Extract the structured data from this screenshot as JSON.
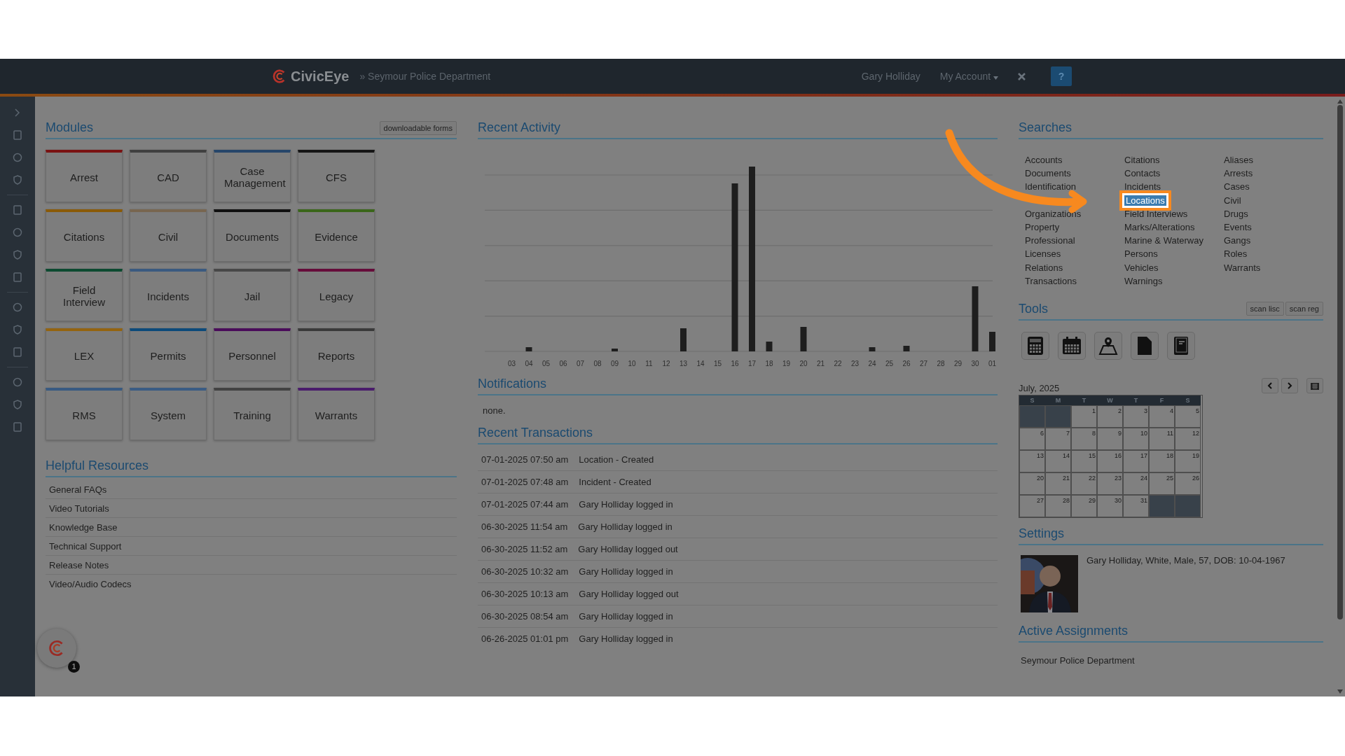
{
  "header": {
    "logo": "CivicEye",
    "breadcrumb": "» Seymour Police Department",
    "user": "Gary Holliday",
    "account_menu": "My Account",
    "help": "?"
  },
  "modules": {
    "title": "Modules",
    "forms_button": "downloadable forms",
    "items": [
      {
        "label": "Arrest",
        "color": "#7a1212"
      },
      {
        "label": "CAD",
        "color": "#404040"
      },
      {
        "label": "Case Management",
        "color": "#26466a"
      },
      {
        "label": "CFS",
        "color": "#151515"
      },
      {
        "label": "Citations",
        "color": "#8a5a08"
      },
      {
        "label": "Civil",
        "color": "#786650"
      },
      {
        "label": "Documents",
        "color": "#101010"
      },
      {
        "label": "Evidence",
        "color": "#3a661a"
      },
      {
        "label": "Field Interview",
        "color": "#0c4a30"
      },
      {
        "label": "Incidents",
        "color": "#3a5a80"
      },
      {
        "label": "Jail",
        "color": "#484848"
      },
      {
        "label": "Legacy",
        "color": "#660c3a"
      },
      {
        "label": "LEX",
        "color": "#946410"
      },
      {
        "label": "Permits",
        "color": "#0c4a7a"
      },
      {
        "label": "Personnel",
        "color": "#4a0c5a"
      },
      {
        "label": "Reports",
        "color": "#3a3a3a"
      },
      {
        "label": "RMS",
        "color": "#385a82"
      },
      {
        "label": "System",
        "color": "#3a5c84"
      },
      {
        "label": "Training",
        "color": "#424242"
      },
      {
        "label": "Warrants",
        "color": "#4a1c6c"
      }
    ]
  },
  "helpful_resources": {
    "title": "Helpful Resources",
    "links": [
      "General FAQs",
      "Video Tutorials",
      "Knowledge Base",
      "Technical Support",
      "Release Notes",
      "Video/Audio Codecs"
    ]
  },
  "recent_activity": {
    "title": "Recent Activity",
    "days": [
      "03",
      "04",
      "05",
      "06",
      "07",
      "08",
      "09",
      "10",
      "11",
      "12",
      "13",
      "14",
      "15",
      "16",
      "17",
      "18",
      "19",
      "20",
      "21",
      "22",
      "23",
      "24",
      "25",
      "26",
      "27",
      "28",
      "29",
      "30",
      "01"
    ]
  },
  "notifications": {
    "title": "Notifications",
    "text": "none."
  },
  "recent_transactions": {
    "title": "Recent Transactions",
    "rows": [
      {
        "time": "07-01-2025 07:50 am",
        "event": "Location - Created"
      },
      {
        "time": "07-01-2025 07:48 am",
        "event": "Incident - Created"
      },
      {
        "time": "07-01-2025 07:44 am",
        "event": "Gary Holliday logged in"
      },
      {
        "time": "06-30-2025 11:54 am",
        "event": "Gary Holliday logged in"
      },
      {
        "time": "06-30-2025 11:52 am",
        "event": "Gary Holliday logged out"
      },
      {
        "time": "06-30-2025 10:32 am",
        "event": "Gary Holliday logged in"
      },
      {
        "time": "06-30-2025 10:13 am",
        "event": "Gary Holliday logged out"
      },
      {
        "time": "06-30-2025 08:54 am",
        "event": "Gary Holliday logged in"
      },
      {
        "time": "06-26-2025 01:01 pm",
        "event": "Gary Holliday logged in"
      }
    ]
  },
  "searches": {
    "title": "Searches",
    "columns": [
      [
        {
          "label": "Accounts",
          "selected": false
        },
        {
          "label": "Documents",
          "selected": false
        },
        {
          "label": "Identification",
          "selected": false
        },
        {
          "label": "Organizations",
          "selected": false,
          "gap_before": true
        },
        {
          "label": "Property",
          "selected": false
        },
        {
          "label": "Professional",
          "selected": false
        },
        {
          "label": "Licenses",
          "selected": false
        },
        {
          "label": "Relations",
          "selected": false
        },
        {
          "label": "Transactions",
          "selected": false
        }
      ],
      [
        {
          "label": "Citations",
          "selected": false
        },
        {
          "label": "Contacts",
          "selected": false
        },
        {
          "label": "Incidents",
          "selected": false
        },
        {
          "label": "Locations",
          "selected": true
        },
        {
          "label": "Field Interviews",
          "selected": false
        },
        {
          "label": "Marks/Alterations",
          "selected": false
        },
        {
          "label": "Marine & Waterway",
          "selected": false
        },
        {
          "label": "Persons",
          "selected": false
        },
        {
          "label": "Vehicles",
          "selected": false
        },
        {
          "label": "Warnings",
          "selected": false
        }
      ],
      [
        {
          "label": "Aliases",
          "selected": false
        },
        {
          "label": "Arrests",
          "selected": false
        },
        {
          "label": "Cases",
          "selected": false
        },
        {
          "label": "Civil",
          "selected": false
        },
        {
          "label": "Drugs",
          "selected": false
        },
        {
          "label": "Events",
          "selected": false
        },
        {
          "label": "Gangs",
          "selected": false
        },
        {
          "label": "Roles",
          "selected": false
        },
        {
          "label": "Warrants",
          "selected": false
        }
      ]
    ]
  },
  "tools": {
    "title": "Tools",
    "buttons": [
      "scan lisc",
      "scan reg"
    ]
  },
  "calendar": {
    "month": "July, 2025",
    "weekdays": [
      "S",
      "M",
      "T",
      "W",
      "T",
      "F",
      "S"
    ],
    "weeks": [
      [
        "1",
        "2",
        "3",
        "4",
        "5"
      ],
      [
        "6",
        "7",
        "8",
        "9",
        "10",
        "11",
        "12"
      ],
      [
        "13",
        "14",
        "15",
        "16",
        "17",
        "18",
        "19"
      ],
      [
        "20",
        "21",
        "22",
        "23",
        "24",
        "25",
        "26"
      ],
      [
        "27",
        "28",
        "29",
        "30",
        "31"
      ]
    ]
  },
  "settings": {
    "title": "Settings",
    "profile": "Gary Holliday, White, Male, 57, DOB: 10-04-1967"
  },
  "active_assignments": {
    "title": "Active Assignments",
    "items": [
      "Seymour Police Department"
    ]
  },
  "assistant": {
    "badge": "1"
  }
}
